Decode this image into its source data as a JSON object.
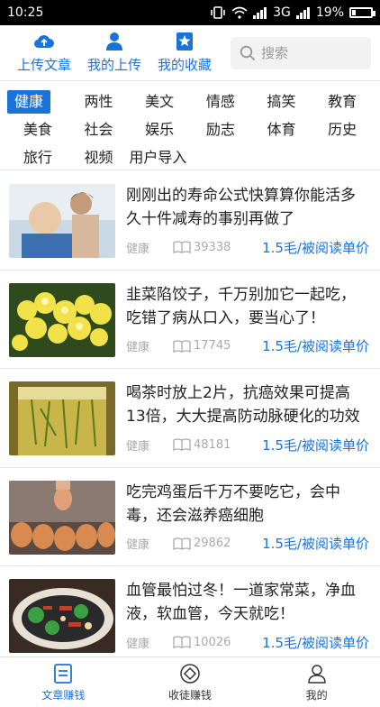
{
  "status_bar": {
    "time": "10:25",
    "network": "3G",
    "battery": "19%"
  },
  "top_nav": {
    "buttons": [
      {
        "label": "上传文章",
        "icon": "cloud-upload-icon"
      },
      {
        "label": "我的上传",
        "icon": "user-icon"
      },
      {
        "label": "我的收藏",
        "icon": "star-bookmark-icon"
      }
    ],
    "search_placeholder": "搜索"
  },
  "categories": [
    [
      "健康",
      "两性",
      "美文",
      "情感",
      "搞笑",
      "教育"
    ],
    [
      "美食",
      "社会",
      "娱乐",
      "励志",
      "体育",
      "历史"
    ],
    [
      "旅行",
      "视频",
      "用户导入"
    ]
  ],
  "active_category": "健康",
  "articles": [
    {
      "title": "刚刚出的寿命公式快算算你能活多久十件减寿的事别再做了",
      "category": "健康",
      "reads": "39338",
      "price": "1.5毛/被阅读单价",
      "thumb": "elderly-haircut"
    },
    {
      "title": "韭菜陷饺子，千万别加它一起吃，吃错了病从口入，要当心了！",
      "category": "健康",
      "reads": "17745",
      "price": "1.5毛/被阅读单价",
      "thumb": "yellow-flowers"
    },
    {
      "title": "喝茶时放上2片，抗癌效果可提高13倍，大大提高防动脉硬化的功效",
      "category": "健康",
      "reads": "48181",
      "price": "1.5毛/被阅读单价",
      "thumb": "tea-glass"
    },
    {
      "title": "吃完鸡蛋后千万不要吃它，会中毒，还会滋养癌细胞",
      "category": "健康",
      "reads": "29862",
      "price": "1.5毛/被阅读单价",
      "thumb": "eggs"
    },
    {
      "title": "血管最怕过冬！一道家常菜，净血液，软血管，今天就吃！",
      "category": "健康",
      "reads": "10026",
      "price": "1.5毛/被阅读单价",
      "thumb": "dish"
    }
  ],
  "bottom_nav": [
    {
      "label": "文章赚钱",
      "icon": "document-icon",
      "active": true
    },
    {
      "label": "收徒赚钱",
      "icon": "diamond-icon",
      "active": false
    },
    {
      "label": "我的",
      "icon": "person-icon",
      "active": false
    }
  ],
  "colors": {
    "accent": "#1a73d9",
    "text": "#222222",
    "muted": "#aaaaaa"
  }
}
